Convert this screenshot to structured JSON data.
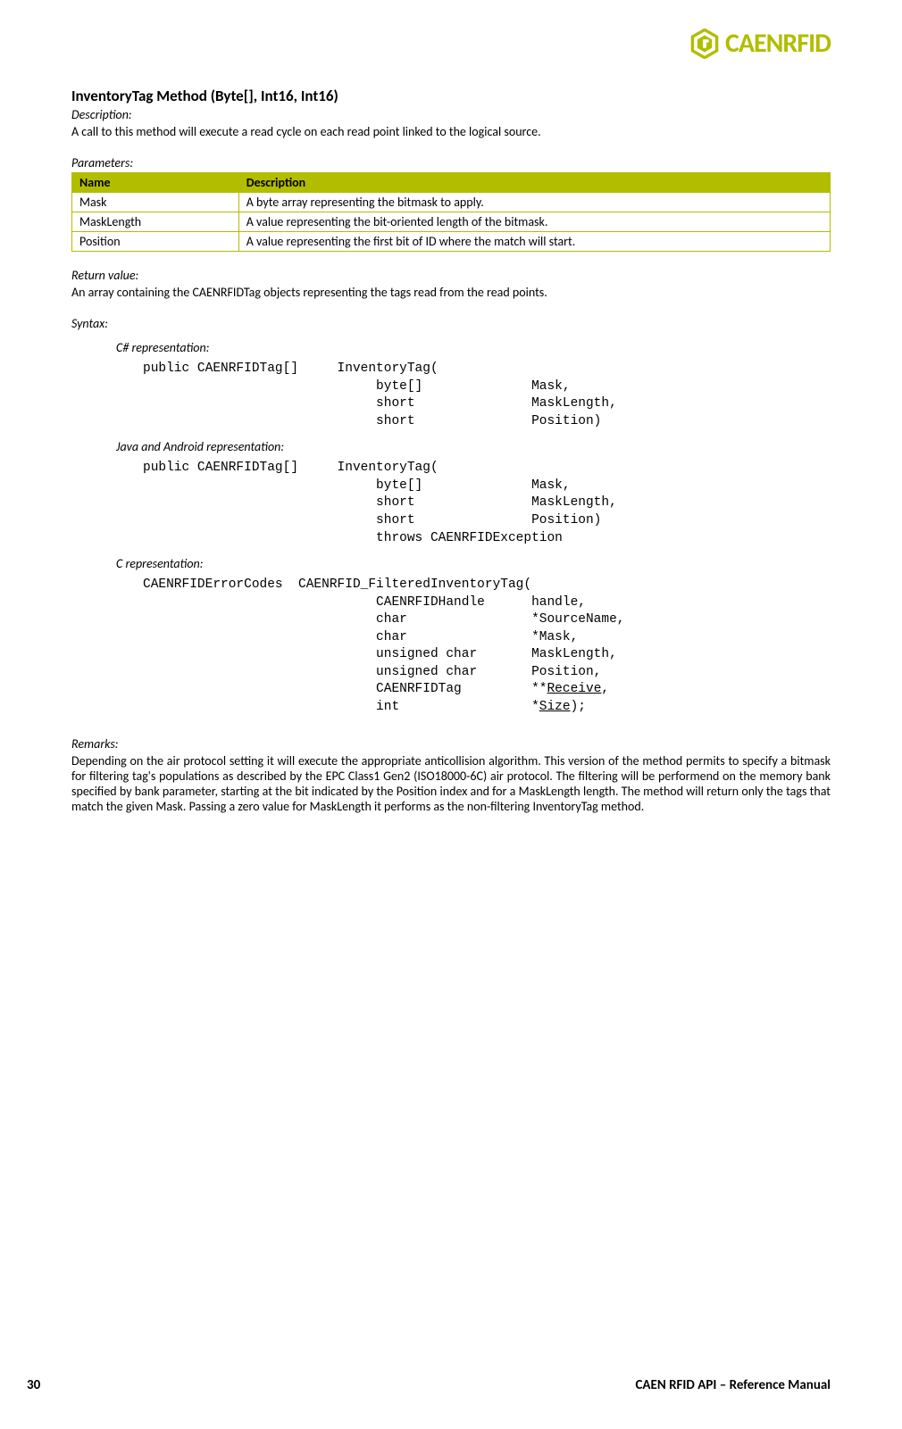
{
  "logo": {
    "text": "CAENRFID"
  },
  "title": "InventoryTag Method (Byte[], Int16, Int16)",
  "description": {
    "label": "Description:",
    "text": "A call to this method will execute a read cycle on each read point linked to the logical source."
  },
  "parameters": {
    "label": "Parameters:",
    "headers": {
      "name": "Name",
      "desc": "Description"
    },
    "rows": [
      {
        "name": "Mask",
        "desc": "A byte array representing the bitmask to apply."
      },
      {
        "name": "MaskLength",
        "desc": "A value representing the bit-oriented length of the bitmask."
      },
      {
        "name": "Position",
        "desc": "A value representing the first bit of ID where the match will start."
      }
    ]
  },
  "return": {
    "label": "Return value:",
    "text": "An array containing the CAENRFIDTag objects representing the tags read from the read points."
  },
  "syntax": {
    "label": "Syntax:",
    "reps": {
      "csharp": {
        "label": "C# representation:",
        "code": "public CAENRFIDTag[]     InventoryTag(\n                              byte[]              Mask,\n                              short               MaskLength,\n                              short               Position)"
      },
      "java": {
        "label": "Java and Android representation:",
        "code": "public CAENRFIDTag[]     InventoryTag(\n                              byte[]              Mask,\n                              short               MaskLength,\n                              short               Position)\n                              throws CAENRFIDException"
      },
      "c": {
        "label": "C representation:"
      }
    }
  },
  "c_code": {
    "l1": "CAENRFIDErrorCodes  CAENRFID_FilteredInventoryTag(",
    "l2": "                              CAENRFIDHandle      handle,",
    "l3": "                              char                *SourceName,",
    "l4": "                              char                *Mask,",
    "l5": "                              unsigned char       MaskLength,",
    "l6": "                              unsigned char       Position,",
    "l7a": "                              CAENRFIDTag         **",
    "l7b": "Receive",
    "l7c": ",",
    "l8a": "                              int                 *",
    "l8b": "Size",
    "l8c": ");"
  },
  "remarks": {
    "label": "Remarks:",
    "text": "Depending on the air protocol setting it will execute the appropriate anticollision algorithm. This version of the method permits to specify a bitmask for filtering tag's populations as described by the EPC Class1 Gen2 (ISO18000-6C) air protocol. The filtering will be performend on the memory bank specified by bank parameter, starting at the bit indicated by the Position index and for a MaskLength length. The method will return only the tags that match the given Mask. Passing a zero value for MaskLength it performs as the non-filtering InventoryTag method."
  },
  "footer": {
    "page": "30",
    "title": "CAEN RFID API – Reference Manual"
  }
}
